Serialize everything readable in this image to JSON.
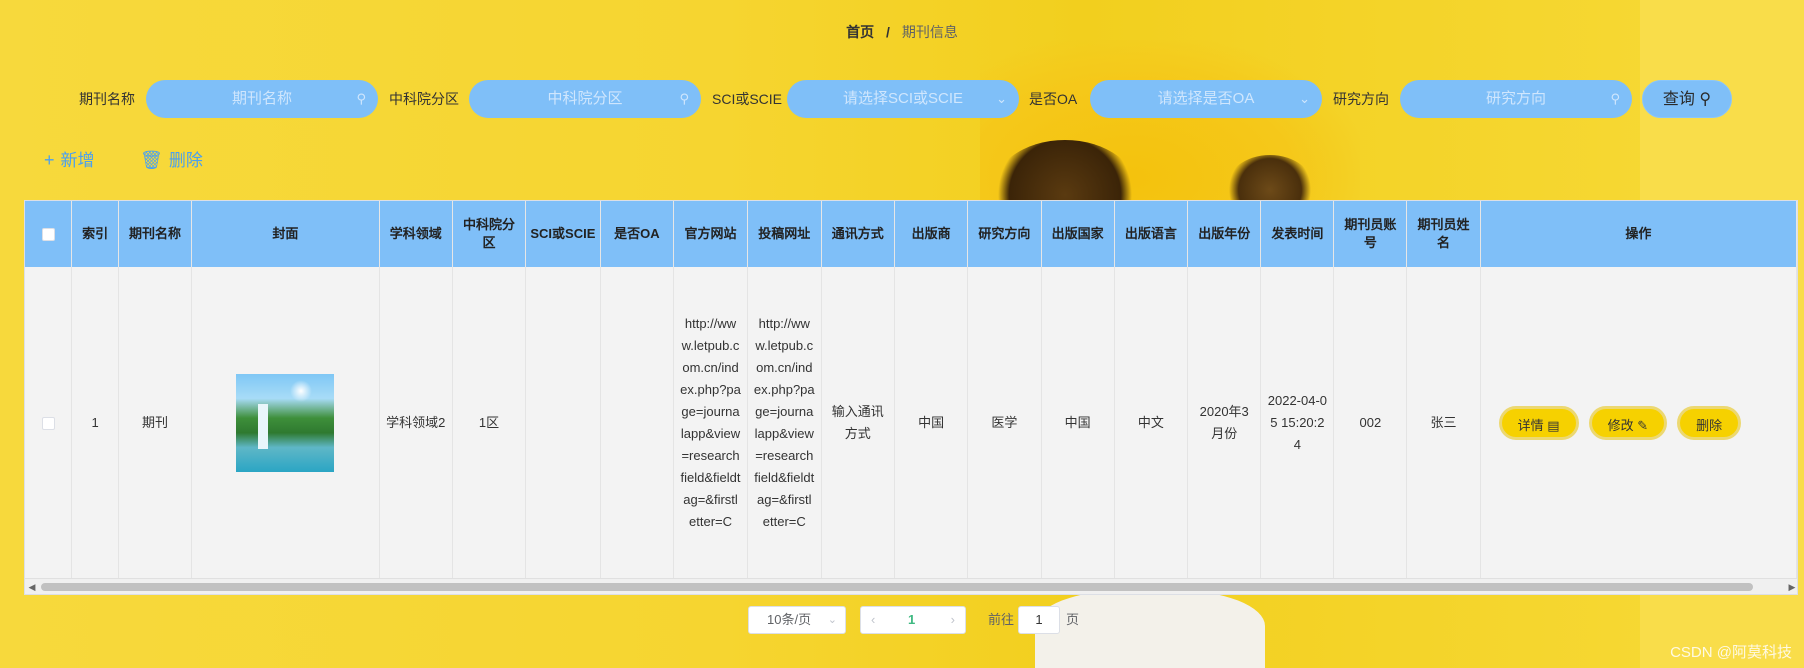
{
  "breadcrumb": {
    "home": "首页",
    "separator": "/",
    "current": "期刊信息"
  },
  "search": {
    "fields": [
      {
        "label": "期刊名称",
        "placeholder": "期刊名称",
        "suffix_icon": "search-icon"
      },
      {
        "label": "中科院分区",
        "placeholder": "中科院分区",
        "suffix_icon": "search-icon"
      },
      {
        "label": "SCI或SCIE",
        "placeholder": "请选择SCI或SCIE",
        "suffix_icon": "chevron-down-icon"
      },
      {
        "label": "是否OA",
        "placeholder": "请选择是否OA",
        "suffix_icon": "chevron-down-icon"
      },
      {
        "label": "研究方向",
        "placeholder": "研究方向",
        "suffix_icon": "search-icon"
      }
    ],
    "query_button": "查询"
  },
  "actions": {
    "add": "新增",
    "delete": "删除"
  },
  "table": {
    "headers": [
      "",
      "索引",
      "期刊名称",
      "封面",
      "学科领域",
      "中科院分区",
      "SCI或SCIE",
      "是否OA",
      "官方网站",
      "投稿网址",
      "通讯方式",
      "出版商",
      "研究方向",
      "出版国家",
      "出版语言",
      "出版年份",
      "发表时间",
      "期刊员账号",
      "期刊员姓名",
      "操作"
    ],
    "rows": [
      {
        "index": "1",
        "name": "期刊",
        "subject": "学科领域2",
        "partition": "1区",
        "sci": "",
        "oa": "",
        "website": "http://www.letpub.com.cn/index.php?page=journalapp&view=researchfield&fieldtag=&firstletter=C",
        "submit_url": "http://www.letpub.com.cn/index.php?page=journalapp&view=researchfield&fieldtag=&firstletter=C",
        "contact": "输入通讯方式",
        "publisher": "中国",
        "direction": "医学",
        "country": "中国",
        "language": "中文",
        "year": "2020年3月份",
        "publish_time": "2022-04-05 15:20:24",
        "account": "002",
        "staff_name": "张三"
      }
    ],
    "row_buttons": {
      "detail": "详情",
      "edit": "修改",
      "delete": "删除"
    }
  },
  "pagination": {
    "page_size": "10条/页",
    "current_page": "1",
    "goto_label": "前往",
    "goto_value": "1",
    "goto_unit": "页"
  },
  "watermark": "CSDN @阿莫科技",
  "colors": {
    "header_bg": "#7fbff8",
    "accent_blue": "#4aa0f0",
    "button_yellow": "#f6d100",
    "page_active": "#3fb982"
  }
}
